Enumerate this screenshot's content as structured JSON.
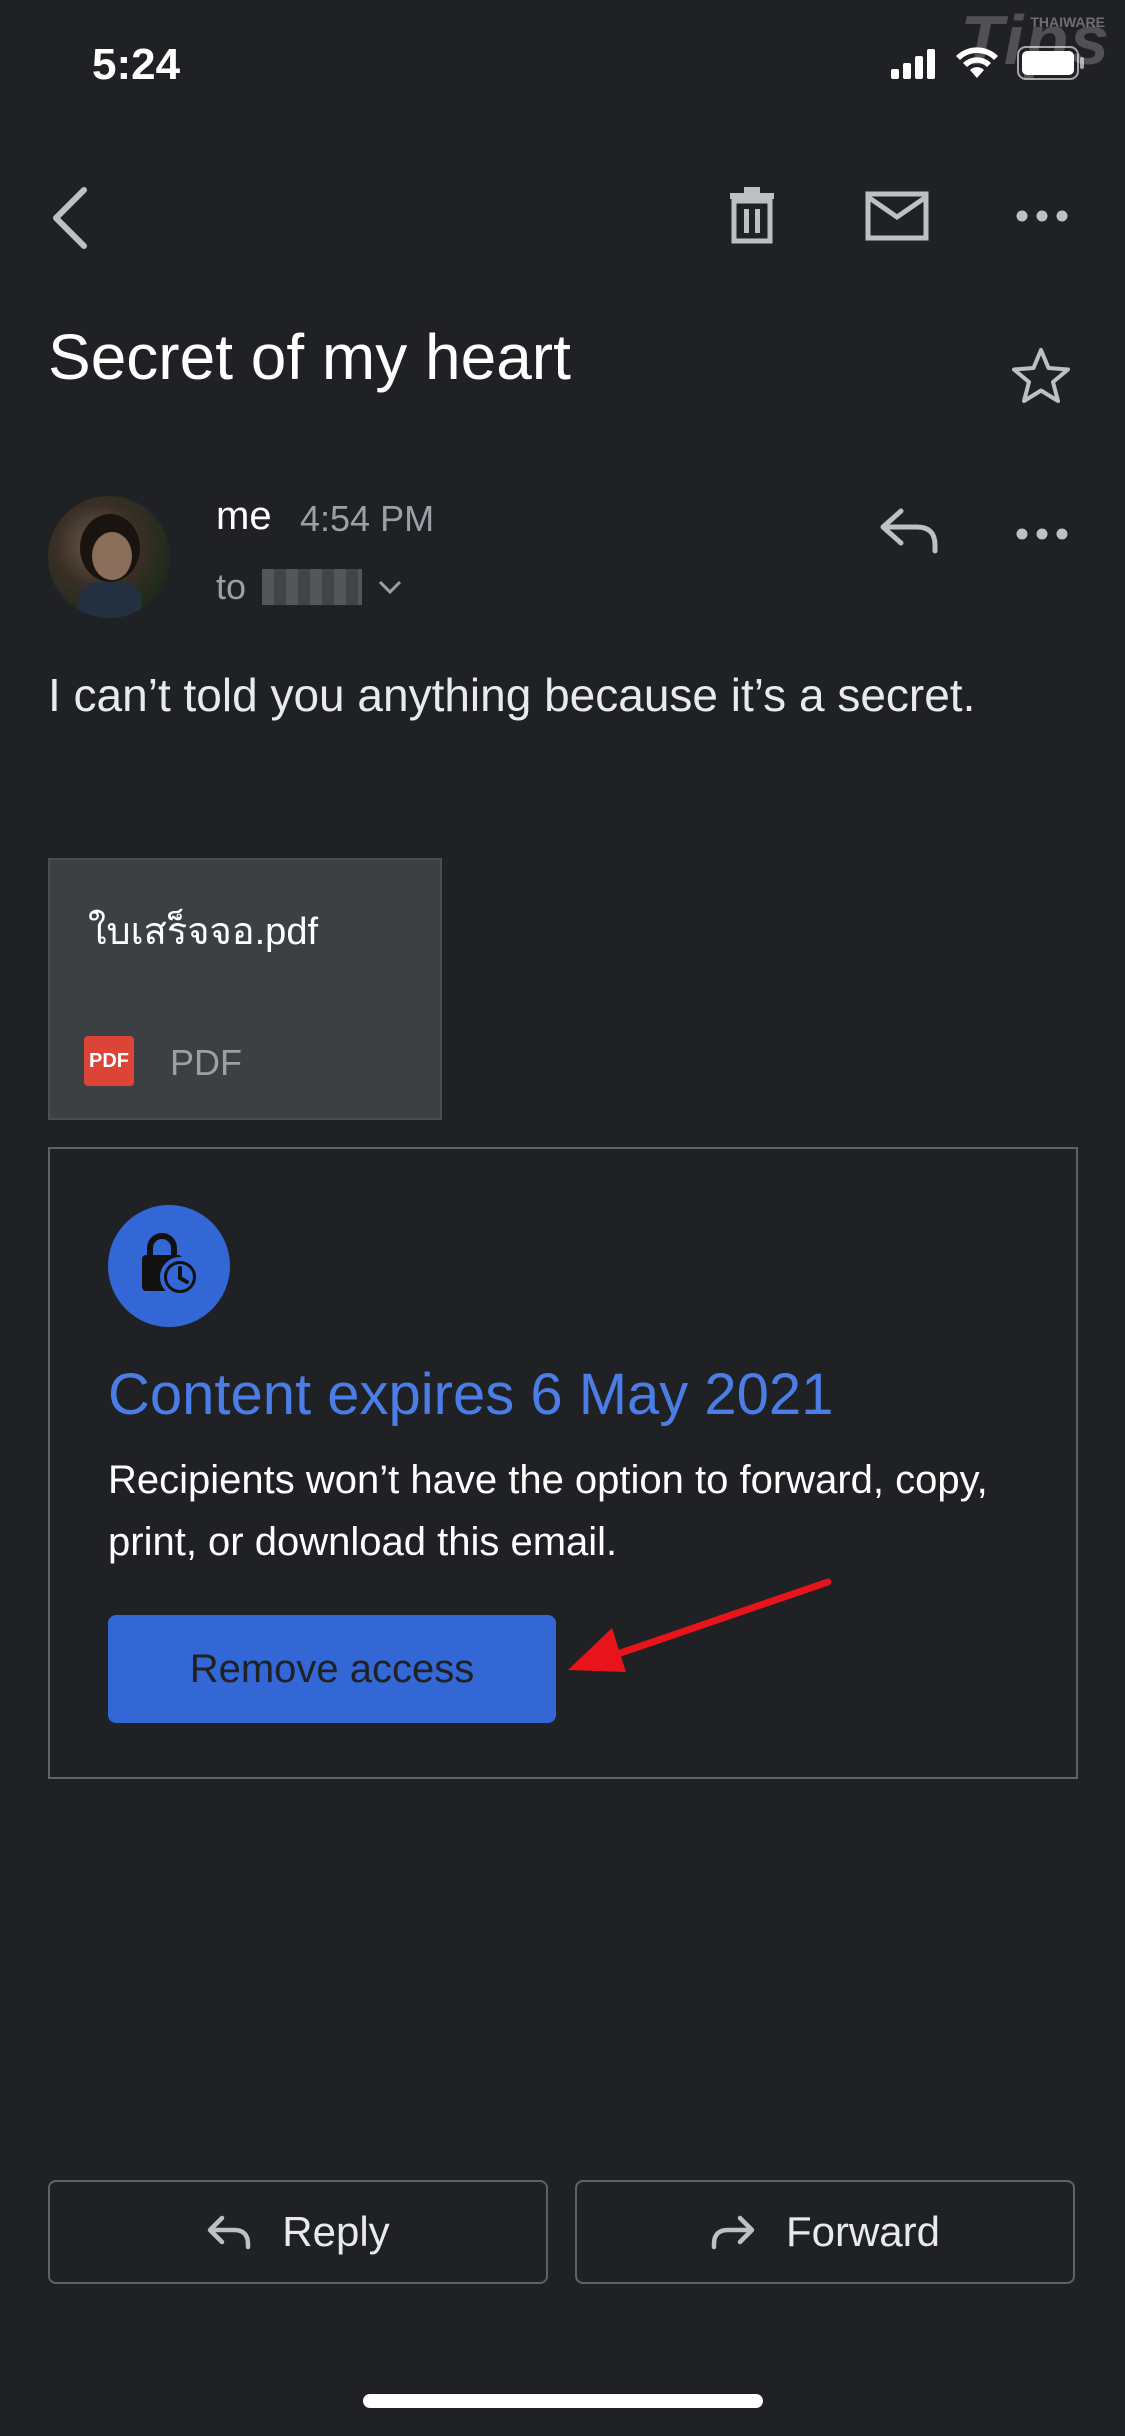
{
  "status_bar": {
    "time": "5:24",
    "watermark": "Tips",
    "watermark_small": "THAIWARE"
  },
  "toolbar": {
    "back_icon": "chevron-left-icon",
    "delete_icon": "trash-icon",
    "mark_unread_icon": "envelope-icon",
    "more_icon": "more-horizontal-icon"
  },
  "email": {
    "subject": "Secret of my heart",
    "sender": "me",
    "time": "4:54 PM",
    "to_label": "to",
    "body": "I can’t told you anything because it’s a secret."
  },
  "attachment": {
    "name": "ใบเสร็จจอ.pdf",
    "badge": "PDF",
    "type": "PDF"
  },
  "confidential": {
    "title": "Content expires 6 May 2021",
    "description": "Recipients won’t have the option to forward, copy, print, or download this email.",
    "button": "Remove access"
  },
  "actions": {
    "reply": "Reply",
    "forward": "Forward"
  },
  "colors": {
    "background": "#202124",
    "accent": "#3367d6",
    "title_blue": "#4a7ee6",
    "annotation_arrow": "#e8141c"
  }
}
